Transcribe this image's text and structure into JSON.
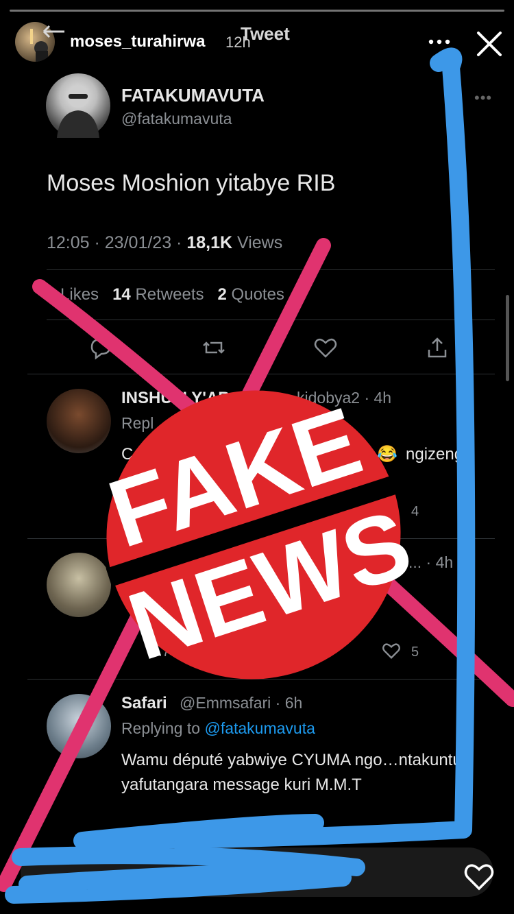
{
  "story": {
    "username": "moses_turahirwa",
    "time": "12h",
    "page_title": "Tweet"
  },
  "tweet": {
    "display_name": "FATAKUMAVUTA",
    "handle": "@fatakumavuta",
    "text": "Moses Moshion yitabye RIB",
    "time": "12:05",
    "date": "23/01/23",
    "views_count": "18,1K",
    "views_label": "Views",
    "likes_count": "6",
    "likes_label": "Likes",
    "retweets_count": "14",
    "retweets_label": "Retweets",
    "quotes_count": "2",
    "quotes_label": "Quotes"
  },
  "replies": [
    {
      "name": "INSHUTI Y'AB",
      "meta": "kidobya2 · 4h",
      "replying": "Repl",
      "text_start": "C",
      "text_end": "ngizeng",
      "emoji": "😂",
      "count": "4"
    },
    {
      "meta": "... · 4h",
      "views": "1.7",
      "likes": "5"
    },
    {
      "name": "Safari",
      "meta": "@Emmsafari · 6h",
      "replying_prefix": "Replying to",
      "replying_to": "@fatakumavuta",
      "text": "Wamu député yabwiye CYUMA ngo…ntakuntu yafutangara message kuri M.M.T"
    }
  ],
  "overlay": {
    "stamp_line1": "FAKE",
    "stamp_line2": "NEWS",
    "stamp_color": "#e0262a",
    "cross_color": "#e0336f",
    "scribble_color": "#3d98e8"
  }
}
